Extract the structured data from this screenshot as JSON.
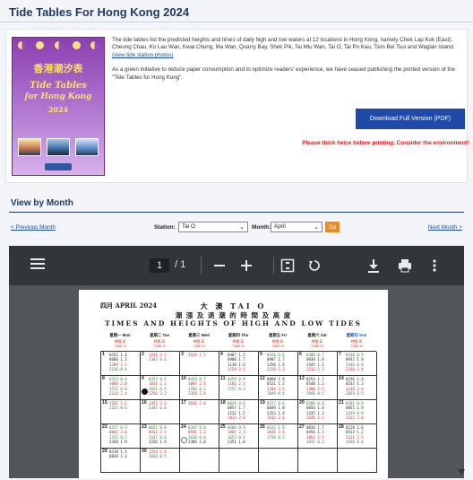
{
  "page": {
    "title": "Tide Tables For Hong Kong 2024"
  },
  "intro": {
    "cover": {
      "cn_title": "香港潮汐表",
      "en_title_1": "Tide Tables",
      "en_title_2": "for Hong Kong",
      "year": "2024"
    },
    "paragraph_1": "The tide tables list the predicted heights and times of daily high and low waters at 12 locations in Hong Kong, namely Chek Lap Kok (East), Cheung Chau, Ko Lau Wan, Kwai Chung, Ma Wan, Quarry Bay, Shek Pik, Tai Miu Wan, Tai O, Tai Po Kau, Tsim Bei Tsui and Waglan Island.",
    "station_link": "(view tide station photos)",
    "paragraph_2": "As a green initiative to reduce paper consumption and to optimize readers' experience, we have ceased publishing the printed version of the \"Tide Tables for Hong Kong\".",
    "download_label": "Download Full Version (PDF)",
    "warning": "Please think twice before printing. Consider the environment!"
  },
  "view_by_month": {
    "title": "View by Month",
    "prev_label": "< Previous Month",
    "next_label": "Next Month >",
    "station_label": "Station:",
    "station_value": "Tai O",
    "month_label": "Month:",
    "month_value": "April",
    "go_label": "Go"
  },
  "viewer": {
    "page_current": "1",
    "page_total": "/ 1",
    "zoom_out_icon": "minus-icon",
    "zoom_in_icon": "plus-icon"
  },
  "pdf": {
    "month": "四月 APRIL 2024",
    "station": "大 澳  TAI  O",
    "title_cn": "潮 漲 及 退 潮 的 時 間 及 高 度",
    "title_en": "TIMES AND HEIGHTS OF HIGH AND LOW TIDES",
    "weekdays": [
      "星期一 Mon",
      "星期二 Tue",
      "星期三 Wed",
      "星期四 Thu",
      "星期五 Fri",
      "星期六 Sat",
      "星期日 Sun"
    ],
    "col_head_1": "時間  高",
    "col_head_2": "TIME   M",
    "weeks": [
      [
        {
          "day": "1",
          "rows": [
            "0352 1.4",
            "0606 1.3",
            "1309 2.1",
            "2136 0.4"
          ]
        },
        {
          "day": "2",
          "rows": [
            "1415 2.2",
            "2303 0.6"
          ]
        },
        {
          "day": "3",
          "rows": [
            "1534 2.2"
          ]
        },
        {
          "day": "4",
          "rows": [
            "0407 1.5",
            "0900 1.7",
            "1130 1.6",
            "1758 2.1"
          ]
        },
        {
          "day": "5",
          "rows": [
            "0526 0.6",
            "0907 1.7",
            "1256 1.4",
            "2159 2.2"
          ]
        },
        {
          "day": "6",
          "rows": [
            "0300 0.7",
            "0936 1.8",
            "1345 1.1",
            "2212 2.3"
          ]
        },
        {
          "day": "7",
          "rows": [
            "0248 0.5",
            "0932 1.9",
            "1446 0.8",
            "2310 2.4"
          ]
        }
      ],
      [
        {
          "day": "8",
          "rows": [
            "0323 0.4",
            "1005 2.0",
            "1512 0.8",
            "2213 2.4"
          ]
        },
        {
          "day": "9",
          "rows": [
            "0357 0.5",
            "1012 2.3",
            "1621 0.5",
            "2256 2.2"
          ]
        },
        {
          "day": "10",
          "rows": [
            "0429 0.7",
            "1007 2.4",
            "1708 0.2",
            "2350 2.0"
          ]
        },
        {
          "day": "11",
          "rows": [
            "0459 0.9",
            "1101 2.1",
            "1757 0.3"
          ]
        },
        {
          "day": "12",
          "rows": [
            "0060 1.8",
            "0521 1.2",
            "1204 2.5",
            "1849 0.4"
          ]
        },
        {
          "day": "13",
          "rows": [
            "0253 1.7",
            "0540 1.2",
            "1300 2.5",
            "1948 0.5"
          ]
        },
        {
          "day": "14",
          "rows": [
            "0256 1.4",
            "0532 1.3",
            "1236 2.4",
            "2059 0.5"
          ]
        }
      ],
      [
        {
          "day": "15",
          "rows": [
            "1337 2.2",
            "2221 0.6"
          ]
        },
        {
          "day": "16",
          "rows": [
            "1453 2.1",
            "2345 0.6"
          ]
        },
        {
          "day": "17",
          "rows": [
            "1646 2.0"
          ]
        },
        {
          "day": "18",
          "rows": [
            "0044 0.6",
            "0857 1.7",
            "1222 1.5",
            "1813 2.0"
          ]
        },
        {
          "day": "19",
          "rows": [
            "0127 0.6",
            "0849 1.8",
            "1253 1.4",
            "1913 2.1"
          ]
        },
        {
          "day": "20",
          "rows": [
            "0200 0.8",
            "0856 1.8",
            "1335 1.3",
            "2034 2.1"
          ]
        },
        {
          "day": "21",
          "rows": [
            "0201 0.8",
            "0855 1.9",
            "1439 0.9",
            "2222 2.0"
          ]
        }
      ],
      [
        {
          "day": "22",
          "rows": [
            "0157 0.9",
            "0847 2.0",
            "1513 0.7",
            "2348 1.9"
          ]
        },
        {
          "day": "23",
          "rows": [
            "0021 0.8",
            "0912 2.1",
            "1547 0.6",
            "2226 1.9"
          ]
        },
        {
          "day": "24",
          "rows": [
            "0345 0.8",
            "0941 2.3",
            "1620 0.6",
            "2309 1.8"
          ]
        },
        {
          "day": "25",
          "rows": [
            "0409 0.9",
            "1007 2.3",
            "1653 0.4",
            "2351 1.8"
          ]
        },
        {
          "day": "26",
          "rows": [
            "0432 1.0",
            "1035 2.4",
            "1758 0.3"
          ]
        },
        {
          "day": "27",
          "rows": [
            "0036 1.7",
            "0456 1.1",
            "1054 2.5",
            "1817 0.3"
          ]
        },
        {
          "day": "28",
          "rows": [
            "0128 1.6",
            "0513 1.2",
            "1121 2.5",
            "1910 0.4"
          ]
        }
      ],
      [
        {
          "day": "29",
          "rows": [
            "0318 1.5",
            "0830 1.3"
          ]
        },
        {
          "day": "30",
          "rows": [
            "1253 2.4",
            "2020 0.5"
          ]
        },
        {
          "day": "",
          "rows": []
        },
        {
          "day": "",
          "rows": []
        },
        {
          "day": "",
          "rows": []
        },
        {
          "day": "",
          "rows": []
        },
        {
          "day": "",
          "rows": []
        }
      ]
    ]
  },
  "colors": {
    "title": "#1e3a6b",
    "link": "#1a4cb8",
    "download_button": "#1f4aa8",
    "warning": "#d81b1b",
    "go_button": "#f08a1c",
    "viewer_toolbar": "#323639",
    "viewer_bg": "#525659"
  }
}
